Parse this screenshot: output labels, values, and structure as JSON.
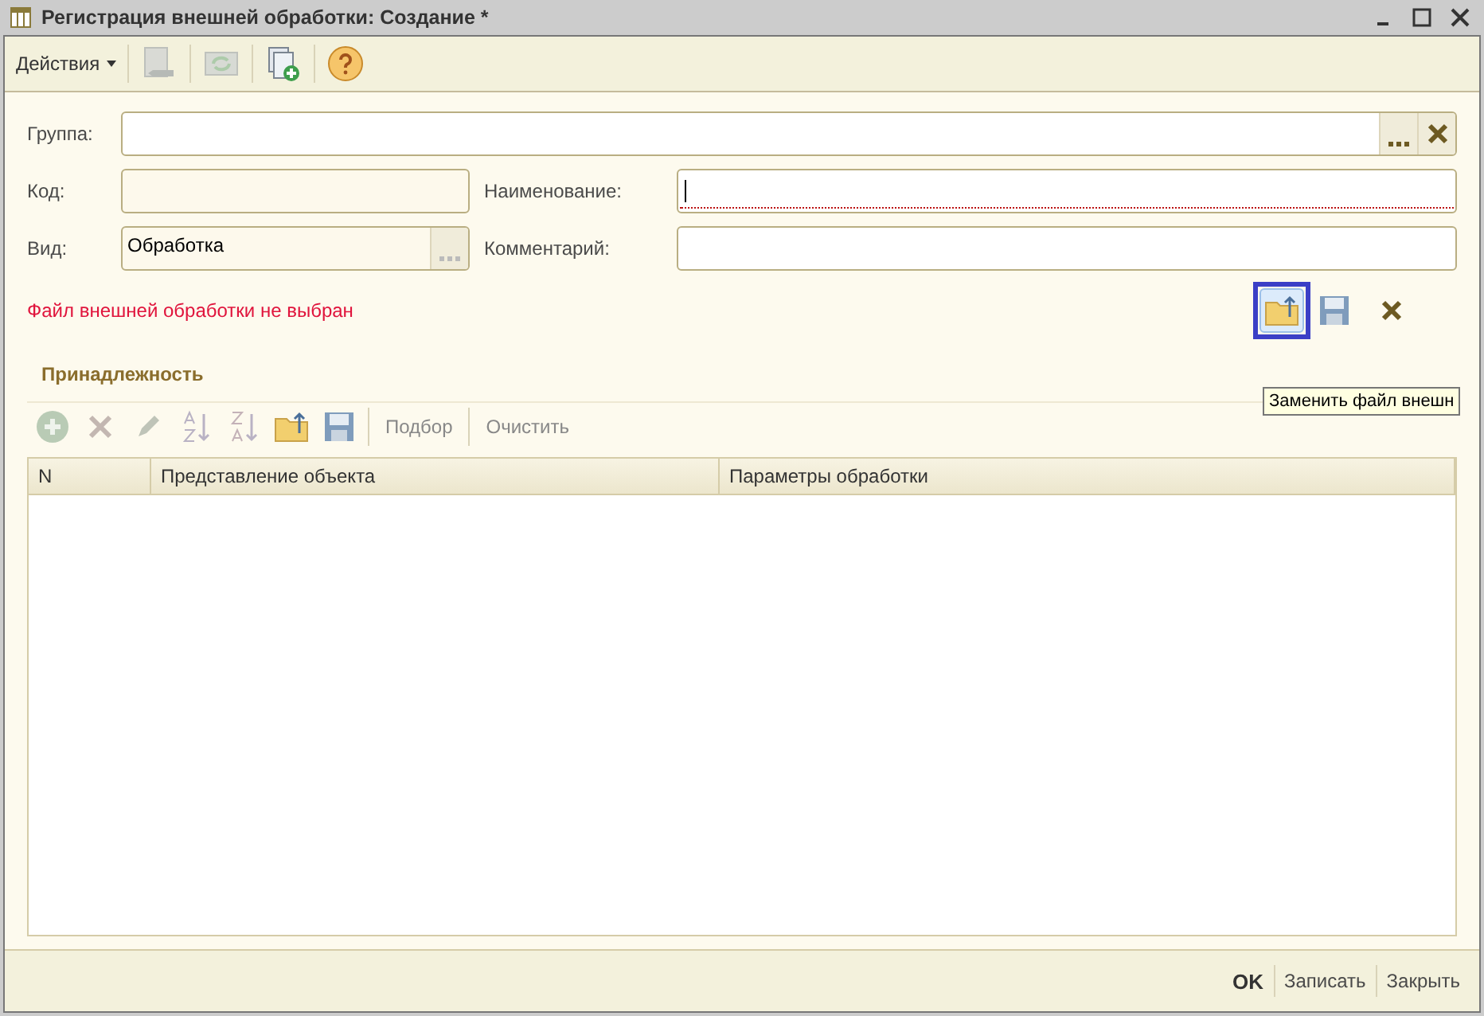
{
  "window": {
    "title": "Регистрация внешней обработки: Создание *"
  },
  "toolbar": {
    "menu": "Действия",
    "buttons": [
      {
        "kind": "back",
        "disabled": true
      },
      {
        "kind": "refresh",
        "disabled": true
      },
      {
        "kind": "copy",
        "disabled": false
      },
      {
        "kind": "help",
        "disabled": false
      }
    ]
  },
  "fields": [
    {
      "label": "Группа:",
      "kind": "select-clear",
      "required": false,
      "disabled": false
    },
    {
      "label": "Код:",
      "kind": "text",
      "required": false,
      "disabled": true
    },
    {
      "label": "Наименование:",
      "kind": "text",
      "required": true,
      "disabled": false
    },
    {
      "label": "Вид:",
      "value": "Обработка",
      "kind": "select",
      "required": false,
      "disabled": true
    },
    {
      "label": "Комментарий:",
      "kind": "text",
      "required": false,
      "disabled": false
    }
  ],
  "file_status": "Файл внешней обработки не выбран",
  "file_buttons": [
    {
      "kind": "open",
      "highlighted": true
    },
    {
      "kind": "save",
      "highlighted": false
    },
    {
      "kind": "clear",
      "highlighted": false
    }
  ],
  "tooltip": "Заменить файл внешн",
  "section": "Принадлежность",
  "table_toolbar": {
    "icons": [
      {
        "kind": "add"
      },
      {
        "kind": "delete"
      },
      {
        "kind": "edit"
      },
      {
        "kind": "sort-asc"
      },
      {
        "kind": "sort-desc"
      },
      {
        "kind": "open"
      },
      {
        "kind": "save"
      }
    ],
    "buttons": [
      "Подбор",
      "Очистить"
    ]
  },
  "table": {
    "columns": [
      "N",
      "Представление объекта",
      "Параметры обработки"
    ]
  },
  "footer": {
    "buttons": [
      {
        "label": "OK",
        "default": true
      },
      {
        "label": "Записать",
        "default": false
      },
      {
        "label": "Закрыть",
        "default": false
      }
    ]
  }
}
